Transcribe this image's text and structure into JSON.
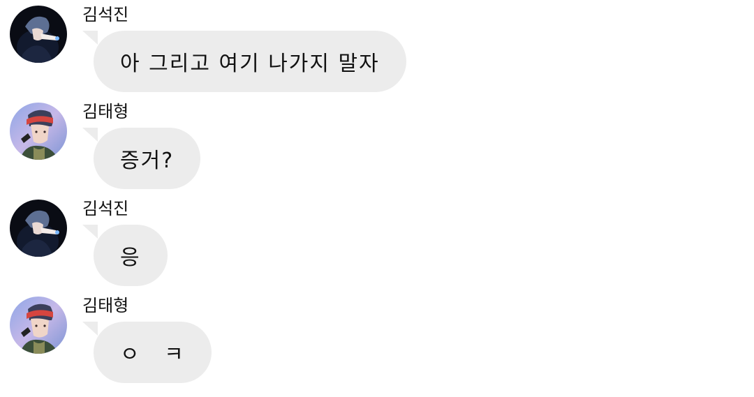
{
  "messages": [
    {
      "sender": "김석진",
      "avatar": "jin-avatar",
      "text": "아 그리고 여기 나가지 말자"
    },
    {
      "sender": "김태형",
      "avatar": "taehyung-avatar",
      "text": "증거?"
    },
    {
      "sender": "김석진",
      "avatar": "jin-avatar",
      "text": "응"
    },
    {
      "sender": "김태형",
      "avatar": "taehyung-avatar",
      "text": "ㅇ ㅋ"
    }
  ],
  "colors": {
    "bubble": "#ececec",
    "text": "#111111",
    "background": "#ffffff"
  }
}
